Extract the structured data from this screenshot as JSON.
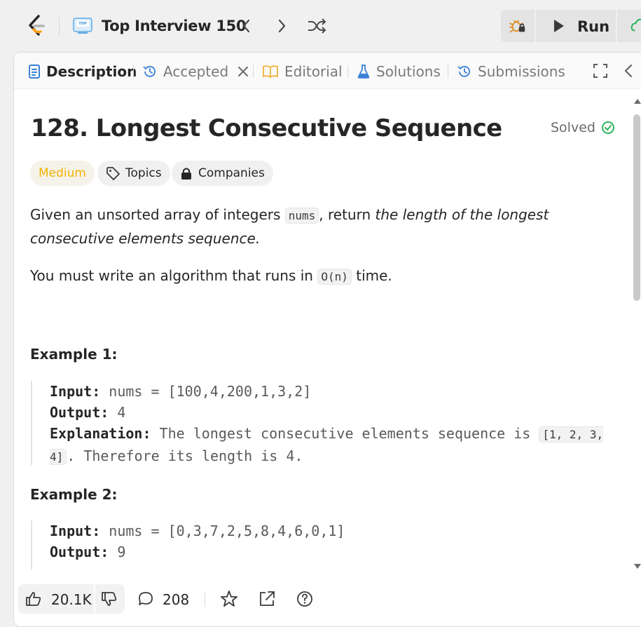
{
  "topbar": {
    "list_title": "Top Interview 150",
    "run_label": "Run",
    "icons": [
      "logo-icon",
      "list-icon",
      "chevron-left-icon",
      "chevron-right-icon",
      "shuffle-icon",
      "debug-icon",
      "play-icon",
      "upload-icon"
    ]
  },
  "tabs": [
    {
      "label": "Description",
      "icon": "description-icon",
      "active": true
    },
    {
      "label": "Accepted",
      "icon": "history-icon",
      "active": false
    },
    {
      "label": "Editorial",
      "icon": "book-icon",
      "active": false
    },
    {
      "label": "Solutions",
      "icon": "flask-icon",
      "active": false
    },
    {
      "label": "Submissions",
      "icon": "history-icon",
      "active": false
    }
  ],
  "problem": {
    "title": "128. Longest Consecutive Sequence",
    "status": "Solved",
    "difficulty": "Medium",
    "topics_label": "Topics",
    "companies_label": "Companies",
    "desc1_pre": "Given an unsorted array of integers ",
    "desc1_code": "nums",
    "desc1_mid": ", return ",
    "desc1_em": "the length of the longest consecutive elements sequence.",
    "desc2_pre": "You must write an algorithm that runs in ",
    "desc2_code": "O(n)",
    "desc2_post": " time."
  },
  "examples": [
    {
      "title": "Example 1:",
      "input_label": "Input:",
      "input": " nums = [100,4,200,1,3,2]",
      "output_label": "Output:",
      "output": " 4",
      "explanation_label": "Explanation:",
      "explanation_pre": " The longest consecutive elements sequence is ",
      "explanation_code": "[1, 2, 3, 4]",
      "explanation_post": ". Therefore its length is 4."
    },
    {
      "title": "Example 2:",
      "input_label": "Input:",
      "input": " nums = [0,3,7,2,5,8,4,6,0,1]",
      "output_label": "Output:",
      "output": " 9"
    }
  ],
  "footer": {
    "likes": "20.1K",
    "comments": "208"
  },
  "colors": {
    "medium": "#f2b300",
    "solved_check": "#2db55d",
    "accent_orange": "#ffa116"
  }
}
